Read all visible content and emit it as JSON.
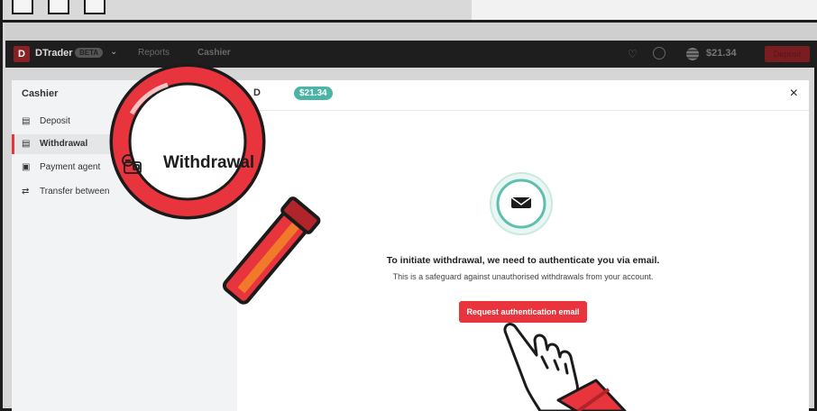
{
  "app": {
    "name": "DTrader",
    "badge": "BETA",
    "nav_reports": "Reports",
    "nav_cashier": "Cashier",
    "balance": "$21.34",
    "deposit_button": "Deposit"
  },
  "cashier": {
    "sidebar_title": "Cashier",
    "items": [
      {
        "label": "Deposit",
        "icon": "wallet-icon",
        "active": false
      },
      {
        "label": "Withdrawal",
        "icon": "withdrawal-icon",
        "active": true
      },
      {
        "label": "Payment agent",
        "icon": "payment-agent-icon",
        "active": false
      },
      {
        "label": "Transfer between",
        "icon": "transfer-icon",
        "active": false
      }
    ],
    "currency_label": "D",
    "amount_badge": "$21.34",
    "close_label": "×"
  },
  "message": {
    "title": "To initiate withdrawal, we need to authenticate you via email.",
    "subtitle": "This is a safeguard against unauthorised withdrawals from your account.",
    "button": "Request authentication email"
  },
  "magnifier": {
    "label": "Withdrawal"
  },
  "colors": {
    "accent_red": "#e8343c",
    "teal": "#4bb4a6",
    "app_bar": "#1e1e1e"
  }
}
